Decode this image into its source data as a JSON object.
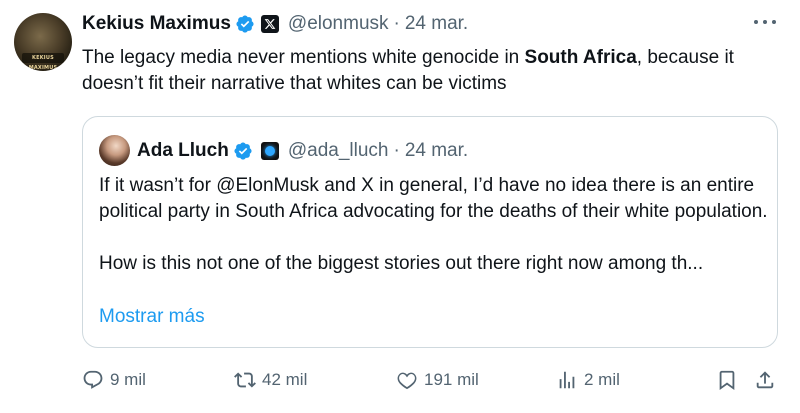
{
  "tweet": {
    "author": {
      "display_name": "Kekius Maximus",
      "handle": "@elonmusk",
      "avatar_badge_text": "KEKIUS MAXIMUS"
    },
    "separator": "·",
    "date": "24 mar.",
    "text_before": "The legacy media never mentions white genocide in ",
    "text_bold": "South Africa",
    "text_after": ", because it doesn’t fit their narrative that whites can be victims",
    "quoted": {
      "display_name": "Ada Lluch",
      "handle": "@ada_lluch",
      "separator": "·",
      "date": "24 mar.",
      "paragraph1": "If it wasn’t for @ElonMusk and X in general, I’d have no idea there is an entire political party in South Africa advocating for the deaths of their white population.",
      "paragraph2": "How is this not one of the biggest stories out there right now among th...",
      "show_more": "Mostrar más"
    },
    "actions": {
      "replies": "9 mil",
      "retweets": "42 mil",
      "likes": "191 mil",
      "views": "2 mil"
    }
  },
  "colors": {
    "text_primary": "#0f1419",
    "text_secondary": "#536471",
    "accent": "#1d9bf0",
    "border": "#cfd9de"
  },
  "icons": [
    "verified-badge-icon",
    "x-logo-icon",
    "more-icon",
    "reply-icon",
    "retweet-icon",
    "like-icon",
    "views-icon",
    "bookmark-icon",
    "share-icon"
  ]
}
